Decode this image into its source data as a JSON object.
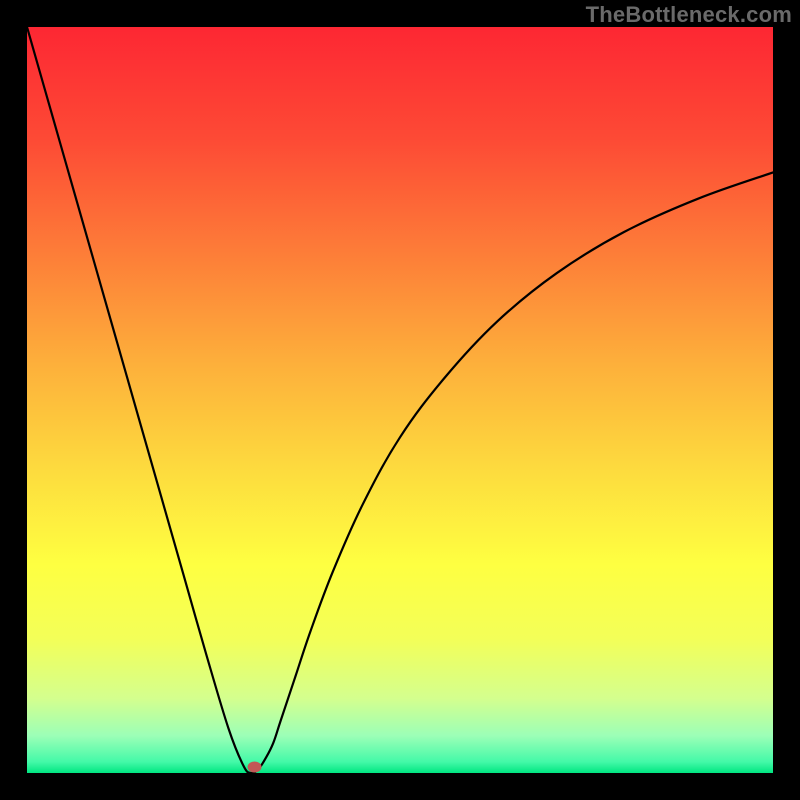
{
  "watermark": "TheBottleneck.com",
  "colors": {
    "frame": "#000000",
    "gradient_stops": [
      {
        "offset": 0.0,
        "color": "#fd2733"
      },
      {
        "offset": 0.15,
        "color": "#fd4a35"
      },
      {
        "offset": 0.3,
        "color": "#fd7c38"
      },
      {
        "offset": 0.45,
        "color": "#fdaf3b"
      },
      {
        "offset": 0.6,
        "color": "#fddd3e"
      },
      {
        "offset": 0.72,
        "color": "#feff41"
      },
      {
        "offset": 0.82,
        "color": "#f3ff58"
      },
      {
        "offset": 0.9,
        "color": "#d4ff8e"
      },
      {
        "offset": 0.95,
        "color": "#9cffb7"
      },
      {
        "offset": 0.985,
        "color": "#44f9a8"
      },
      {
        "offset": 1.0,
        "color": "#00e681"
      }
    ],
    "curve": "#000000",
    "marker": "#c25856"
  },
  "chart_data": {
    "type": "line",
    "title": "",
    "xlabel": "",
    "ylabel": "",
    "xlim": [
      0,
      100
    ],
    "ylim": [
      0,
      100
    ],
    "x": [
      0,
      3,
      6,
      9,
      12,
      15,
      18,
      21,
      24,
      27,
      29,
      30,
      31,
      32,
      33,
      34,
      36,
      38,
      41,
      45,
      50,
      56,
      63,
      71,
      80,
      90,
      100
    ],
    "values": [
      100,
      89.5,
      79,
      68.5,
      58,
      47.5,
      37,
      26.5,
      16,
      6,
      1,
      0,
      0.5,
      2,
      4,
      7,
      13,
      19,
      27,
      36,
      45,
      53,
      60.5,
      67,
      72.5,
      77,
      80.5
    ],
    "marker": {
      "x": 30.5,
      "y": 0.8
    },
    "notes": "V-shaped bottleneck curve; minimum (~0%) near x≈30; right branch rises with decreasing slope toward ~80 at x=100. Values estimated visually (no axis ticks present)."
  }
}
